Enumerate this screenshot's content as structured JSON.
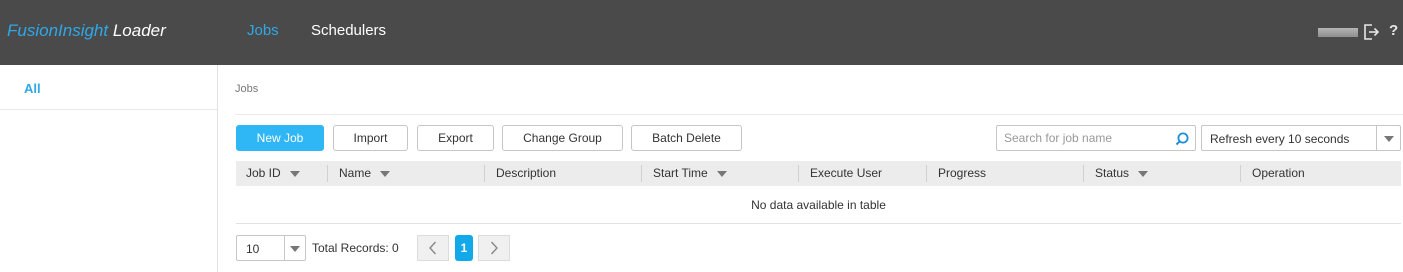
{
  "header": {
    "logo_brand": "FusionInsight",
    "logo_product": " Loader",
    "nav": [
      {
        "label": "Jobs",
        "active": true
      },
      {
        "label": "Schedulers",
        "active": false
      }
    ],
    "help_label": "?",
    "icons": [
      "logout-icon",
      "help-icon"
    ],
    "accent_color": "#2fa8e8",
    "bar_color": "#4a4a4a"
  },
  "sidebar": {
    "items": [
      {
        "label": "All",
        "selected": true
      }
    ]
  },
  "main": {
    "breadcrumb": "Jobs",
    "toolbar": {
      "new_job": "New Job",
      "import": "Import",
      "export": "Export",
      "change_group": "Change Group",
      "batch_delete": "Batch Delete",
      "primary_color": "#2fb6f4"
    },
    "search": {
      "placeholder": "Search for job name",
      "value": ""
    },
    "refresh": {
      "selected": "Refresh every 10 seconds"
    },
    "table": {
      "columns": [
        {
          "label": "Job ID",
          "sortable": true
        },
        {
          "label": "Name",
          "sortable": true
        },
        {
          "label": "Description",
          "sortable": false
        },
        {
          "label": "Start Time",
          "sortable": true
        },
        {
          "label": "Execute User",
          "sortable": false
        },
        {
          "label": "Progress",
          "sortable": false
        },
        {
          "label": "Status",
          "sortable": true
        },
        {
          "label": "Operation",
          "sortable": false
        }
      ],
      "rows": [],
      "empty_message": "No data available in table"
    },
    "pagination": {
      "page_size": "10",
      "total_records": "Total Records: 0",
      "current_page": "1"
    }
  }
}
